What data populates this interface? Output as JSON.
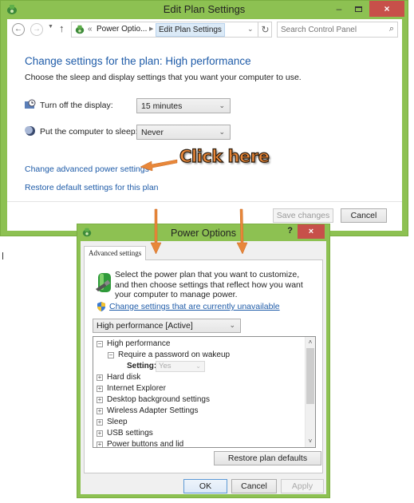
{
  "edit_plan_window": {
    "title": "Edit Plan Settings",
    "app_icon": "power-options-icon",
    "controls": {
      "minimize": "–",
      "maximize": "",
      "close": "×"
    },
    "nav": {
      "back_icon": "←",
      "forward_icon": "→",
      "recent_icon": "▼",
      "up_icon": "↑",
      "breadcrumb": [
        "Power Optio...",
        "Edit Plan Settings"
      ],
      "breadcrumb_chevron": "«",
      "breadcrumb_separator": "▶",
      "dropdown_icon": "⌄",
      "refresh_icon": "↻"
    },
    "search": {
      "placeholder": "Search Control Panel",
      "value": "",
      "icon": "⌕"
    },
    "heading": "Change settings for the plan: High performance",
    "subheading": "Choose the sleep and display settings that you want your computer to use.",
    "settings": [
      {
        "label": "Turn off the display:",
        "value": "15 minutes",
        "icon": "display-icon"
      },
      {
        "label": "Put the computer to sleep:",
        "value": "Never",
        "icon": "sleep-icon"
      }
    ],
    "links": {
      "advanced": "Change advanced power settings",
      "restore": "Restore default settings for this plan"
    },
    "buttons": {
      "save": "Save changes",
      "cancel": "Cancel"
    }
  },
  "annotation": {
    "text": "Click here",
    "color": "#e8873a"
  },
  "power_options_dialog": {
    "title": "Power Options",
    "help": "?",
    "close": "×",
    "tab": "Advanced settings",
    "intro": "Select the power plan that you want to customize, and then choose settings that reflect how you want your computer to manage power.",
    "unavailable_link": "Change settings that are currently unavailable",
    "plan_select": "High performance [Active]",
    "tree": [
      {
        "label": "High performance",
        "toggle": "−",
        "level": 0
      },
      {
        "label": "Require a password on wakeup",
        "toggle": "−",
        "level": 1
      },
      {
        "label": "Hard disk",
        "toggle": "+",
        "level": 0
      },
      {
        "label": "Internet Explorer",
        "toggle": "+",
        "level": 0
      },
      {
        "label": "Desktop background settings",
        "toggle": "+",
        "level": 0
      },
      {
        "label": "Wireless Adapter Settings",
        "toggle": "+",
        "level": 0
      },
      {
        "label": "Sleep",
        "toggle": "+",
        "level": 0
      },
      {
        "label": "USB settings",
        "toggle": "+",
        "level": 0
      },
      {
        "label": "Power buttons and lid",
        "toggle": "+",
        "level": 0
      }
    ],
    "tree_setting": {
      "label": "Setting:",
      "value": "Yes"
    },
    "scroll": {
      "up": "˄",
      "down": "˅"
    },
    "buttons": {
      "restore": "Restore plan defaults",
      "ok": "OK",
      "cancel": "Cancel",
      "apply": "Apply"
    }
  },
  "colors": {
    "window_frame": "#8dc152",
    "close_button": "#c7504a",
    "link": "#1e5ba8"
  }
}
